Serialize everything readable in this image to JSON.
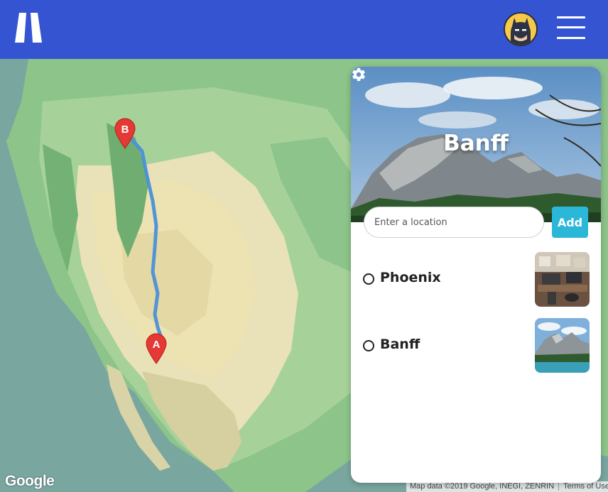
{
  "app": {
    "logo_icon": "road-logo-icon",
    "avatar_icon": "batman-avatar-icon",
    "menu_icon": "hamburger-menu-icon",
    "brand_color": "#3454d1"
  },
  "map": {
    "markers": [
      {
        "label": "B",
        "place": "Banff"
      },
      {
        "label": "A",
        "place": "Phoenix"
      }
    ],
    "route_color": "#4a90d9",
    "google_logo": "Google",
    "attribution": "Map data ©2019 Google, INEGI, ZENRIN",
    "terms": "Terms of Use"
  },
  "panel": {
    "title": "Banff",
    "settings_icon": "gear-icon",
    "input_placeholder": "Enter a location",
    "input_value": "",
    "add_label": "Add",
    "add_color": "#2bb8d8",
    "locations": [
      {
        "name": "Phoenix",
        "thumbnail": "office-photo",
        "selected": false
      },
      {
        "name": "Banff",
        "thumbnail": "mountain-lake-photo",
        "selected": false
      }
    ]
  }
}
